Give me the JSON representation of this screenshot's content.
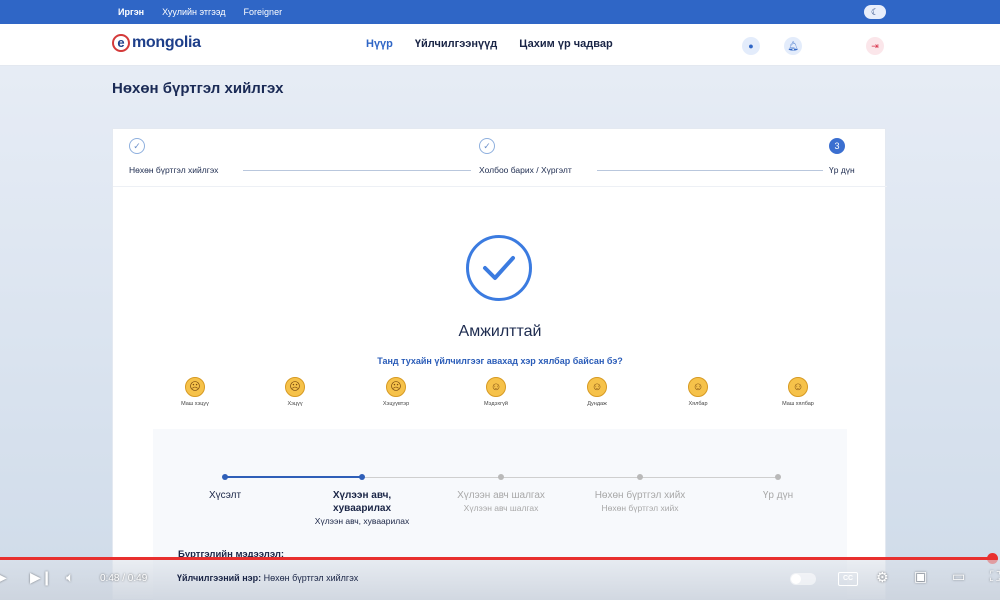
{
  "topbar": {
    "links": [
      "Иргэн",
      "Хуулийн этгээд",
      "Foreigner"
    ],
    "theme_icon": "moon-icon"
  },
  "header": {
    "logo": {
      "e": "e",
      "word": "mongolia"
    },
    "nav": [
      "Нүүр",
      "Үйлчилгээнүүд",
      "Цахим үр чадвар"
    ],
    "icons": [
      "chat-icon",
      "bell-icon",
      "logout-icon"
    ]
  },
  "page": {
    "title": "Нөхөн бүртгэл хийлгэх"
  },
  "stepper": {
    "steps": [
      {
        "label": "Нөхөн бүртгэл хийлгэх",
        "mark": "✓"
      },
      {
        "label": "Холбоо барих / Хүргэлт",
        "mark": "✓"
      },
      {
        "label": "Үр дүн",
        "mark": "3"
      }
    ]
  },
  "result": {
    "status": "Амжилттай",
    "question": "Танд тухайн үйлчилгээг авахад хэр хялбар байсан бэ?",
    "ratings": [
      "Маш хэцүү",
      "Хэцүү",
      "Хэцүүвтэр",
      "Мэдэхгүй",
      "Дундаж",
      "Хялбар",
      "Маш хялбар"
    ],
    "faces": [
      "☹",
      "☹",
      "☹",
      "☺",
      "☺",
      "☺",
      "☺"
    ]
  },
  "progress": {
    "steps": [
      {
        "label": "Хүсэлт",
        "sub": ""
      },
      {
        "label": "Хүлээн авч, хуваарилах",
        "sub": "Хүлээн авч, хуваарилах"
      },
      {
        "label": "Хүлээн авч шалгах",
        "sub": "Хүлээн авч шалгах"
      },
      {
        "label": "Нөхөн бүртгэл хийх",
        "sub": "Нөхөн бүртгэл хийх"
      },
      {
        "label": "Үр дүн",
        "sub": ""
      }
    ],
    "active_count": 2,
    "colors": {
      "active": "#2f5fb8",
      "inactive": "#b9b9b9"
    },
    "info_label": "Бүртгэлийн мэдээлэл:"
  },
  "service": {
    "label": "Үйлчилгээний нэр:",
    "value": "Нөхөн бүртгэл хийлгэх"
  },
  "player": {
    "time": "0:48 / 0:49",
    "progress_fraction": 0.98,
    "cc": "CC"
  }
}
